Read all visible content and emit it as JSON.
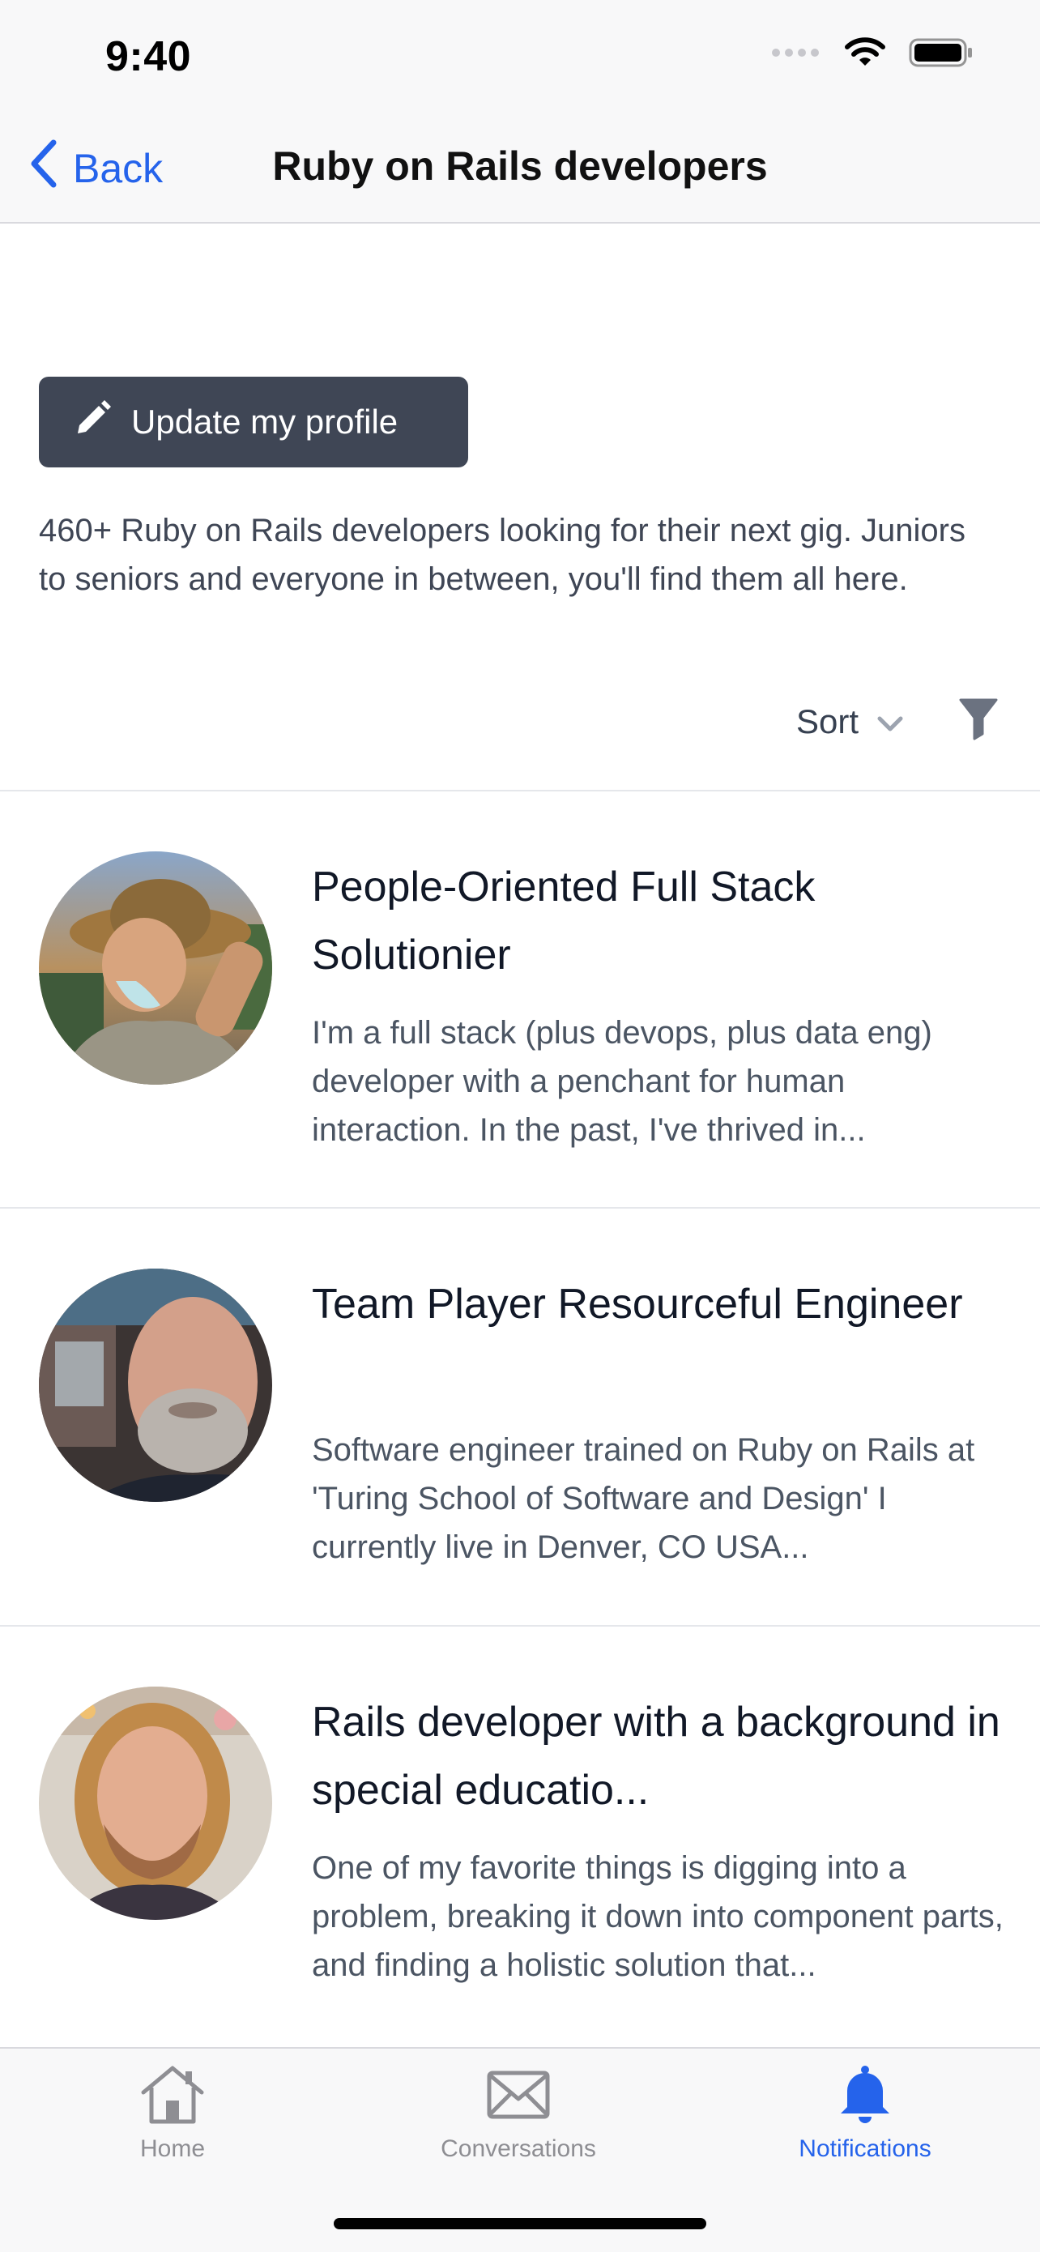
{
  "status_bar": {
    "time": "9:40"
  },
  "nav": {
    "back_label": "Back",
    "title": "Ruby on Rails developers"
  },
  "profile": {
    "update_label": "Update my profile"
  },
  "intro": {
    "text": "460+ Ruby on Rails developers looking for their next gig. Juniors to seniors and everyone in between, you'll find them all here."
  },
  "controls": {
    "sort_label": "Sort"
  },
  "developers": [
    {
      "title": "People-Oriented Full Stack Solutionier",
      "description": "I'm a full stack (plus devops, plus data eng) developer with a penchant for human interaction. In the past, I've thrived in..."
    },
    {
      "title": "Team Player Resourceful Engineer",
      "description": "Software engineer trained on Ruby on Rails at 'Turing School of Software and Design' I currently live in Denver, CO USA..."
    },
    {
      "title": "Rails developer with a background in special educatio...",
      "description": "One of my favorite things is digging into a problem, breaking it down into component parts, and finding a holistic solution that..."
    }
  ],
  "tabs": [
    {
      "label": "Home",
      "icon": "home-icon",
      "active": false
    },
    {
      "label": "Conversations",
      "icon": "envelope-icon",
      "active": false
    },
    {
      "label": "Notifications",
      "icon": "bell-icon",
      "active": true
    }
  ],
  "colors": {
    "accent": "#2563eb",
    "button_dark": "#3f4655",
    "inactive_tab": "#8e8e93"
  }
}
